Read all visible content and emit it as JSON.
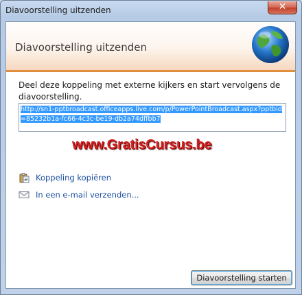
{
  "window": {
    "title": "Diavoorstelling uitzenden",
    "close_label": "✕"
  },
  "banner": {
    "title": "Diavoorstelling uitzenden",
    "icon": "globe-icon"
  },
  "main": {
    "instructions": "Deel deze koppeling met externe kijkers en start vervolgens de diavoorstelling.",
    "link_url": "http://sn1-pptbroadcast.officeapps.live.com/p/PowerPointBroadcast.aspx?pptbid=85232b1a-fc66-4c3c-be19-db2a74dffbb7",
    "watermark": "www.GratisCursus.be",
    "actions": [
      {
        "label": "Koppeling kopiëren",
        "icon": "clipboard-icon"
      },
      {
        "label": "In een e-mail verzenden...",
        "icon": "email-icon"
      }
    ]
  },
  "footer": {
    "start_button_label": "Diavoorstelling starten"
  },
  "colors": {
    "accent_orange": "#e38d3e",
    "link_blue": "#1d4fa0",
    "selection_blue": "#3399ff",
    "watermark_red": "#d32020"
  }
}
